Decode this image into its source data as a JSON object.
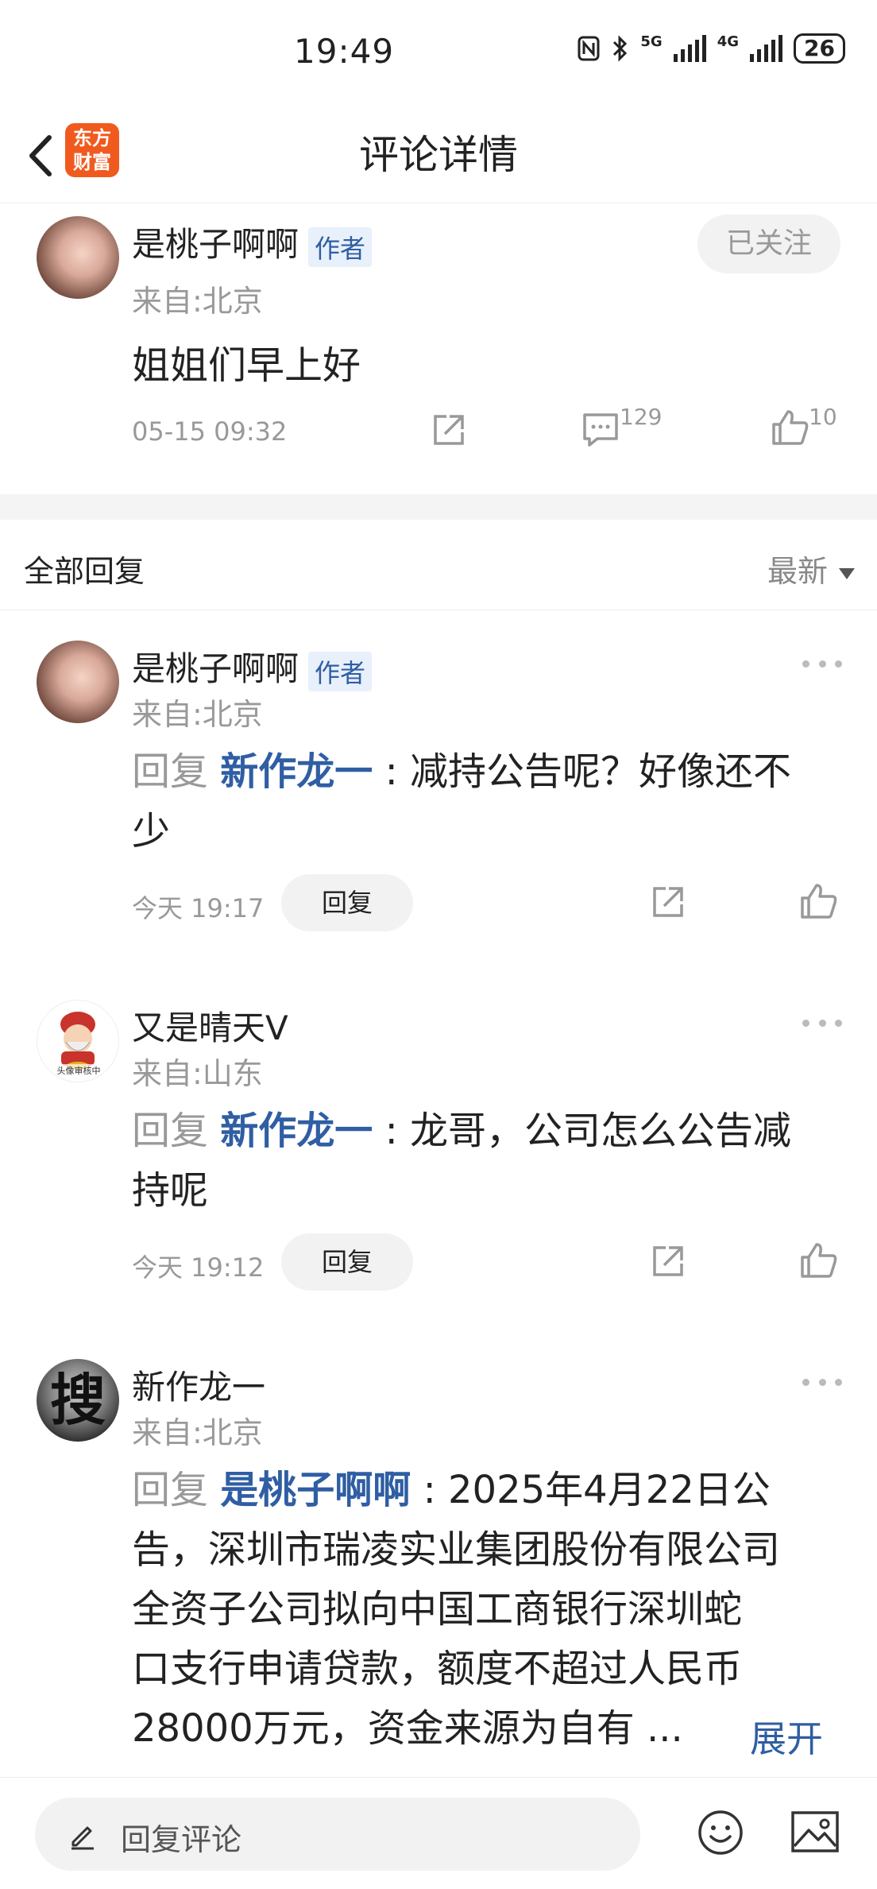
{
  "status_bar": {
    "time": "19:49",
    "net1": "5G",
    "net2": "4G",
    "battery": "26"
  },
  "nav": {
    "title": "评论详情",
    "logo_line1": "东方",
    "logo_line2": "财富"
  },
  "post": {
    "username": "是桃子啊啊",
    "author_tag": "作者",
    "location": "来自:北京",
    "follow_label": "已关注",
    "text": "姐姐们早上好",
    "time": "05-15 09:32",
    "comment_count": "129",
    "like_count": "10"
  },
  "replies_header": {
    "title": "全部回复",
    "sort_label": "最新"
  },
  "replies": [
    {
      "username": "是桃子啊啊",
      "author_tag": "作者",
      "location": "来自:北京",
      "prefix": "回复",
      "target": "新作龙一",
      "line1": ": 减持公告呢？好像还不",
      "line2": "少",
      "time": "今天 19:17",
      "reply_label": "回复"
    },
    {
      "username": "又是晴天V",
      "location": "来自:山东",
      "avatar_caption": "头像审核中",
      "prefix": "回复",
      "target": "新作龙一",
      "line1": ": 龙哥，公司怎么公告减",
      "line2": "持呢",
      "time": "今天 19:12",
      "reply_label": "回复"
    },
    {
      "username": "新作龙一",
      "location": "来自:北京",
      "avatar_char": "搜",
      "prefix": "回复",
      "target": "是桃子啊啊",
      "line1": ": 2025年4月22日公",
      "line2": "告，深圳市瑞凌实业集团股份有限公司",
      "line3": "全资子公司拟向中国工商银行深圳蛇",
      "line4": "口支行申请贷款，额度不超过人民币",
      "line5": "28000万元，资金来源为自有 ...",
      "expand_label": "展开"
    }
  ],
  "bottom_bar": {
    "placeholder": "回复评论"
  },
  "colors": {
    "accent_blue": "#2f5ea3",
    "logo_orange": "#f05a1e",
    "muted": "#999999"
  }
}
